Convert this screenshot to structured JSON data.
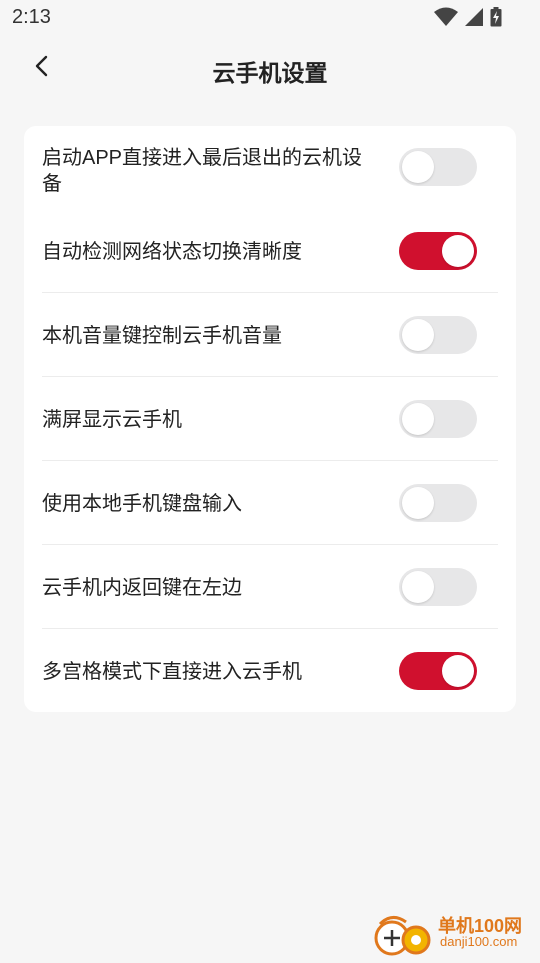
{
  "status_bar": {
    "time": "2:13",
    "icons": [
      "wifi-icon",
      "signal-icon",
      "battery-charging-icon"
    ]
  },
  "header": {
    "title": "云手机设置",
    "back_icon": "chevron-left-icon"
  },
  "settings": [
    {
      "label": "启动APP直接进入最后退出的云机设备",
      "on": false
    },
    {
      "label": "自动检测网络状态切换清晰度",
      "on": true
    },
    {
      "label": "本机音量键控制云手机音量",
      "on": false
    },
    {
      "label": "满屏显示云手机",
      "on": false
    },
    {
      "label": "使用本地手机键盘输入",
      "on": false
    },
    {
      "label": "云手机内返回键在左边",
      "on": false
    },
    {
      "label": "多宫格模式下直接进入云手机",
      "on": true
    }
  ],
  "colors": {
    "accent": "#d0102e",
    "toggle_off": "#e7e7e8",
    "background": "#f6f6f6",
    "card": "#ffffff"
  },
  "watermark": {
    "name": "单机100网",
    "url": "danji100.com"
  }
}
